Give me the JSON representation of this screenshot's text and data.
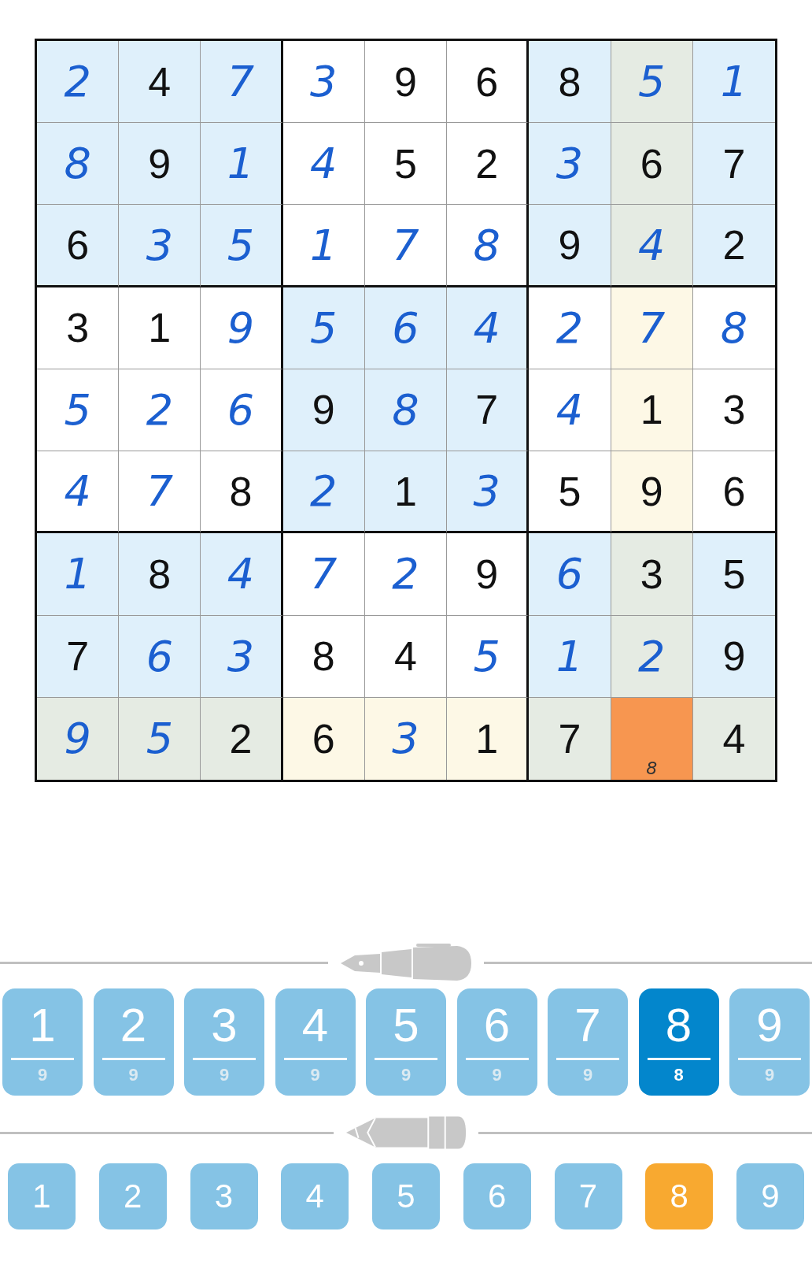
{
  "grid": [
    [
      {
        "value": "2",
        "kind": "entered",
        "color": "#dff0fb",
        "selected": false
      },
      {
        "value": "4",
        "kind": "given",
        "color": "#dff0fb",
        "selected": false
      },
      {
        "value": "7",
        "kind": "entered",
        "color": "#dff0fb",
        "selected": false
      },
      {
        "value": "3",
        "kind": "entered",
        "color": "#ffffff",
        "selected": false
      },
      {
        "value": "9",
        "kind": "given",
        "color": "#ffffff",
        "selected": false
      },
      {
        "value": "6",
        "kind": "given",
        "color": "#ffffff",
        "selected": false
      },
      {
        "value": "8",
        "kind": "given",
        "color": "#dff0fb",
        "selected": false
      },
      {
        "value": "5",
        "kind": "entered",
        "color": "#e5ebe3",
        "selected": false
      },
      {
        "value": "1",
        "kind": "entered",
        "color": "#dff0fb",
        "selected": false
      }
    ],
    [
      {
        "value": "8",
        "kind": "entered",
        "color": "#dff0fb",
        "selected": false
      },
      {
        "value": "9",
        "kind": "given",
        "color": "#dff0fb",
        "selected": false
      },
      {
        "value": "1",
        "kind": "entered",
        "color": "#dff0fb",
        "selected": false
      },
      {
        "value": "4",
        "kind": "entered",
        "color": "#ffffff",
        "selected": false
      },
      {
        "value": "5",
        "kind": "given",
        "color": "#ffffff",
        "selected": false
      },
      {
        "value": "2",
        "kind": "given",
        "color": "#ffffff",
        "selected": false
      },
      {
        "value": "3",
        "kind": "entered",
        "color": "#dff0fb",
        "selected": false
      },
      {
        "value": "6",
        "kind": "given",
        "color": "#e5ebe3",
        "selected": false
      },
      {
        "value": "7",
        "kind": "given",
        "color": "#dff0fb",
        "selected": false
      }
    ],
    [
      {
        "value": "6",
        "kind": "given",
        "color": "#dff0fb",
        "selected": false
      },
      {
        "value": "3",
        "kind": "entered",
        "color": "#dff0fb",
        "selected": false
      },
      {
        "value": "5",
        "kind": "entered",
        "color": "#dff0fb",
        "selected": false
      },
      {
        "value": "1",
        "kind": "entered",
        "color": "#ffffff",
        "selected": false
      },
      {
        "value": "7",
        "kind": "entered",
        "color": "#ffffff",
        "selected": false
      },
      {
        "value": "8",
        "kind": "entered",
        "color": "#ffffff",
        "selected": false
      },
      {
        "value": "9",
        "kind": "given",
        "color": "#dff0fb",
        "selected": false
      },
      {
        "value": "4",
        "kind": "entered",
        "color": "#e5ebe3",
        "selected": false
      },
      {
        "value": "2",
        "kind": "given",
        "color": "#dff0fb",
        "selected": false
      }
    ],
    [
      {
        "value": "3",
        "kind": "given",
        "color": "#ffffff",
        "selected": false
      },
      {
        "value": "1",
        "kind": "given",
        "color": "#ffffff",
        "selected": false
      },
      {
        "value": "9",
        "kind": "entered",
        "color": "#ffffff",
        "selected": false
      },
      {
        "value": "5",
        "kind": "entered",
        "color": "#dff0fb",
        "selected": false
      },
      {
        "value": "6",
        "kind": "entered",
        "color": "#dff0fb",
        "selected": false
      },
      {
        "value": "4",
        "kind": "entered",
        "color": "#dff0fb",
        "selected": false
      },
      {
        "value": "2",
        "kind": "entered",
        "color": "#ffffff",
        "selected": false
      },
      {
        "value": "7",
        "kind": "entered",
        "color": "#fdf8e6",
        "selected": false
      },
      {
        "value": "8",
        "kind": "entered",
        "color": "#ffffff",
        "selected": false
      }
    ],
    [
      {
        "value": "5",
        "kind": "entered",
        "color": "#ffffff",
        "selected": false
      },
      {
        "value": "2",
        "kind": "entered",
        "color": "#ffffff",
        "selected": false
      },
      {
        "value": "6",
        "kind": "entered",
        "color": "#ffffff",
        "selected": false
      },
      {
        "value": "9",
        "kind": "given",
        "color": "#dff0fb",
        "selected": false
      },
      {
        "value": "8",
        "kind": "entered",
        "color": "#dff0fb",
        "selected": false
      },
      {
        "value": "7",
        "kind": "given",
        "color": "#dff0fb",
        "selected": false
      },
      {
        "value": "4",
        "kind": "entered",
        "color": "#ffffff",
        "selected": false
      },
      {
        "value": "1",
        "kind": "given",
        "color": "#fdf8e6",
        "selected": false
      },
      {
        "value": "3",
        "kind": "given",
        "color": "#ffffff",
        "selected": false
      }
    ],
    [
      {
        "value": "4",
        "kind": "entered",
        "color": "#ffffff",
        "selected": false
      },
      {
        "value": "7",
        "kind": "entered",
        "color": "#ffffff",
        "selected": false
      },
      {
        "value": "8",
        "kind": "given",
        "color": "#ffffff",
        "selected": false
      },
      {
        "value": "2",
        "kind": "entered",
        "color": "#dff0fb",
        "selected": false
      },
      {
        "value": "1",
        "kind": "given",
        "color": "#dff0fb",
        "selected": false
      },
      {
        "value": "3",
        "kind": "entered",
        "color": "#dff0fb",
        "selected": false
      },
      {
        "value": "5",
        "kind": "given",
        "color": "#ffffff",
        "selected": false
      },
      {
        "value": "9",
        "kind": "given",
        "color": "#fdf8e6",
        "selected": false
      },
      {
        "value": "6",
        "kind": "given",
        "color": "#ffffff",
        "selected": false
      }
    ],
    [
      {
        "value": "1",
        "kind": "entered",
        "color": "#dff0fb",
        "selected": false
      },
      {
        "value": "8",
        "kind": "given",
        "color": "#dff0fb",
        "selected": false
      },
      {
        "value": "4",
        "kind": "entered",
        "color": "#dff0fb",
        "selected": false
      },
      {
        "value": "7",
        "kind": "entered",
        "color": "#ffffff",
        "selected": false
      },
      {
        "value": "2",
        "kind": "entered",
        "color": "#ffffff",
        "selected": false
      },
      {
        "value": "9",
        "kind": "given",
        "color": "#ffffff",
        "selected": false
      },
      {
        "value": "6",
        "kind": "entered",
        "color": "#dff0fb",
        "selected": false
      },
      {
        "value": "3",
        "kind": "given",
        "color": "#e5ebe3",
        "selected": false
      },
      {
        "value": "5",
        "kind": "given",
        "color": "#dff0fb",
        "selected": false
      }
    ],
    [
      {
        "value": "7",
        "kind": "given",
        "color": "#dff0fb",
        "selected": false
      },
      {
        "value": "6",
        "kind": "entered",
        "color": "#dff0fb",
        "selected": false
      },
      {
        "value": "3",
        "kind": "entered",
        "color": "#dff0fb",
        "selected": false
      },
      {
        "value": "8",
        "kind": "given",
        "color": "#ffffff",
        "selected": false
      },
      {
        "value": "4",
        "kind": "given",
        "color": "#ffffff",
        "selected": false
      },
      {
        "value": "5",
        "kind": "entered",
        "color": "#ffffff",
        "selected": false
      },
      {
        "value": "1",
        "kind": "entered",
        "color": "#dff0fb",
        "selected": false
      },
      {
        "value": "2",
        "kind": "entered",
        "color": "#e5ebe3",
        "selected": false
      },
      {
        "value": "9",
        "kind": "given",
        "color": "#dff0fb",
        "selected": false
      }
    ],
    [
      {
        "value": "9",
        "kind": "entered",
        "color": "#e5ebe3",
        "selected": false
      },
      {
        "value": "5",
        "kind": "entered",
        "color": "#e5ebe3",
        "selected": false
      },
      {
        "value": "2",
        "kind": "given",
        "color": "#e5ebe3",
        "selected": false
      },
      {
        "value": "6",
        "kind": "given",
        "color": "#fdf8e6",
        "selected": false
      },
      {
        "value": "3",
        "kind": "entered",
        "color": "#fdf8e6",
        "selected": false
      },
      {
        "value": "1",
        "kind": "given",
        "color": "#fdf8e6",
        "selected": false
      },
      {
        "value": "7",
        "kind": "given",
        "color": "#e5ebe3",
        "selected": false
      },
      {
        "notes": [
          "8"
        ],
        "kind": "empty",
        "selected": true
      },
      {
        "value": "4",
        "kind": "given",
        "color": "#e5ebe3",
        "selected": false
      }
    ]
  ],
  "pen_keys": [
    {
      "digit": "1",
      "count": "9",
      "selected": false
    },
    {
      "digit": "2",
      "count": "9",
      "selected": false
    },
    {
      "digit": "3",
      "count": "9",
      "selected": false
    },
    {
      "digit": "4",
      "count": "9",
      "selected": false
    },
    {
      "digit": "5",
      "count": "9",
      "selected": false
    },
    {
      "digit": "6",
      "count": "9",
      "selected": false
    },
    {
      "digit": "7",
      "count": "9",
      "selected": false
    },
    {
      "digit": "8",
      "count": "8",
      "selected": true
    },
    {
      "digit": "9",
      "count": "9",
      "selected": false
    }
  ],
  "pencil_keys": [
    {
      "digit": "1",
      "selected": false
    },
    {
      "digit": "2",
      "selected": false
    },
    {
      "digit": "3",
      "selected": false
    },
    {
      "digit": "4",
      "selected": false
    },
    {
      "digit": "5",
      "selected": false
    },
    {
      "digit": "6",
      "selected": false
    },
    {
      "digit": "7",
      "selected": false
    },
    {
      "digit": "8",
      "selected": true
    },
    {
      "digit": "9",
      "selected": false
    }
  ]
}
